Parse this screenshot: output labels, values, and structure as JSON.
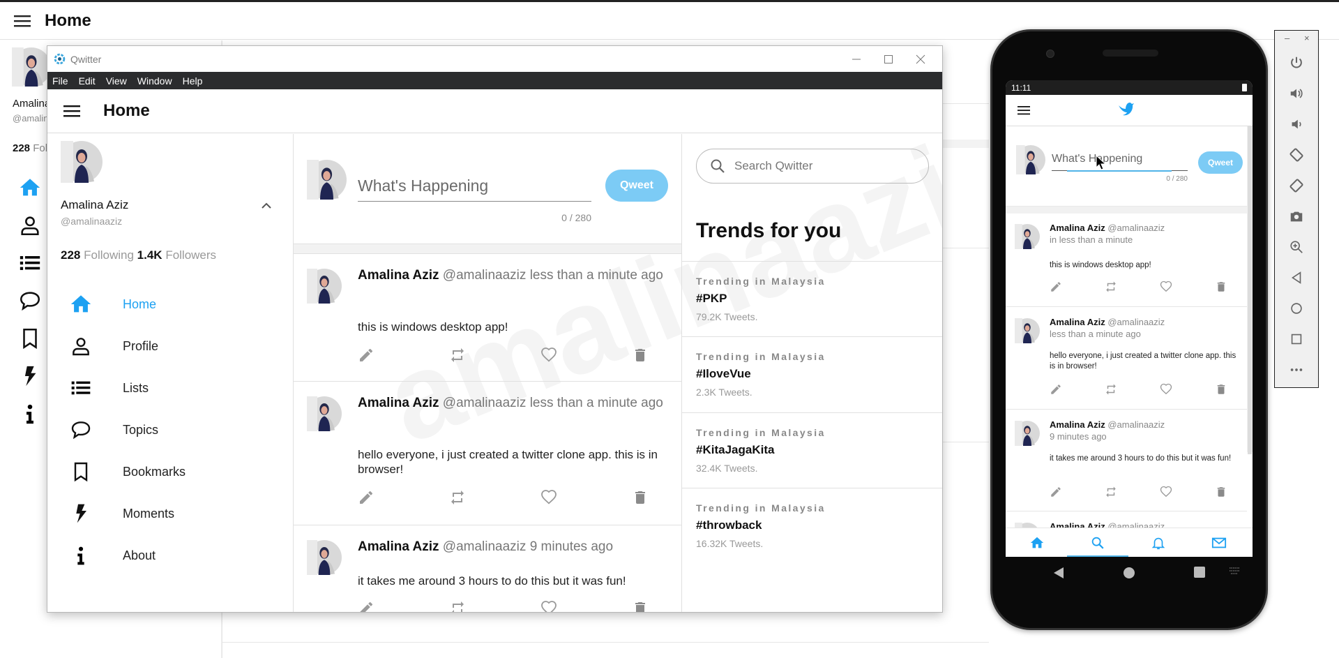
{
  "background_app": {
    "header_title": "Home",
    "user_name": "Amalina Aziz",
    "user_handle": "@amalinaaziz",
    "following_count": "228",
    "following_label": "Following"
  },
  "window": {
    "title": "Qwitter",
    "controls": {
      "minimize": "minimize-icon",
      "maximize": "maximize-icon",
      "close": "close-icon"
    },
    "menu": [
      "File",
      "Edit",
      "View",
      "Window",
      "Help"
    ]
  },
  "app": {
    "header_title": "Home",
    "watermark": "amalinaaziz",
    "accent_color": "#1da1f2",
    "user": {
      "name": "Amalina Aziz",
      "handle": "@amalinaaziz",
      "following_count": "228",
      "following_label": "Following",
      "followers_count": "1.4K",
      "followers_label": "Followers"
    },
    "nav": [
      {
        "label": "Home",
        "icon": "home-icon",
        "active": true
      },
      {
        "label": "Profile",
        "icon": "user-icon"
      },
      {
        "label": "Lists",
        "icon": "list-icon"
      },
      {
        "label": "Topics",
        "icon": "chat-bubble-icon"
      },
      {
        "label": "Bookmarks",
        "icon": "bookmark-icon"
      },
      {
        "label": "Moments",
        "icon": "lightning-icon"
      },
      {
        "label": "About",
        "icon": "info-icon"
      }
    ],
    "composer": {
      "placeholder": "What's Happening",
      "value": "",
      "counter": "0 / 280",
      "button": "Qweet"
    },
    "tweets": [
      {
        "name": "Amalina Aziz",
        "handle": "@amalinaaziz",
        "time": "less than a minute ago",
        "text": "this is windows desktop app!"
      },
      {
        "name": "Amalina Aziz",
        "handle": "@amalinaaziz",
        "time": "less than a minute ago",
        "text": "hello everyone, i just created a twitter clone app. this is in browser!"
      },
      {
        "name": "Amalina Aziz",
        "handle": "@amalinaaziz",
        "time": "9 minutes ago",
        "text": "it takes me around 3 hours to do this but it was fun!"
      }
    ],
    "tweet_actions": [
      "edit-icon",
      "retweet-icon",
      "like-icon",
      "delete-icon"
    ],
    "search_placeholder": "Search Qwitter",
    "trends_title": "Trends for you",
    "trends": [
      {
        "location": "Trending in Malaysia",
        "tag": "#PKP",
        "count": "79.2K Tweets."
      },
      {
        "location": "Trending in Malaysia",
        "tag": "#IloveVue",
        "count": "2.3K Tweets."
      },
      {
        "location": "Trending in Malaysia",
        "tag": "#KitaJagaKita",
        "count": "32.4K Tweets."
      },
      {
        "location": "Trending in Malaysia",
        "tag": "#throwback",
        "count": "16.32K Tweets."
      }
    ]
  },
  "phone": {
    "time": "11:11",
    "composer": {
      "placeholder": "What's Happening",
      "counter": "0 / 280",
      "button": "Qweet"
    },
    "tweets": [
      {
        "name": "Amalina Aziz",
        "handle": "@amalinaaziz",
        "time": "in less than a minute",
        "text": "this is windows desktop app!"
      },
      {
        "name": "Amalina Aziz",
        "handle": "@amalinaaziz",
        "time": "less than a minute ago",
        "text": "hello everyone, i just created a twitter clone app. this is in browser!"
      },
      {
        "name": "Amalina Aziz",
        "handle": "@amalinaaziz",
        "time": "9 minutes ago",
        "text": "it takes me around 3 hours to do this but it was fun!"
      },
      {
        "name": "Amalina Aziz",
        "handle": "@amalinaaziz"
      }
    ],
    "tabs": [
      "home-icon",
      "search-icon",
      "bell-icon",
      "mail-icon"
    ],
    "system_nav": [
      "back-icon",
      "home-circle-icon",
      "recents-icon",
      "keyboard-icon"
    ]
  },
  "emulator_toolbar": {
    "window_controls": [
      "minimize",
      "close"
    ],
    "buttons": [
      "power-icon",
      "volume-up-icon",
      "volume-down-icon",
      "rotate-left-icon",
      "rotate-right-icon",
      "camera-icon",
      "zoom-icon",
      "back-icon",
      "home-icon",
      "overview-icon",
      "more-icon"
    ]
  }
}
